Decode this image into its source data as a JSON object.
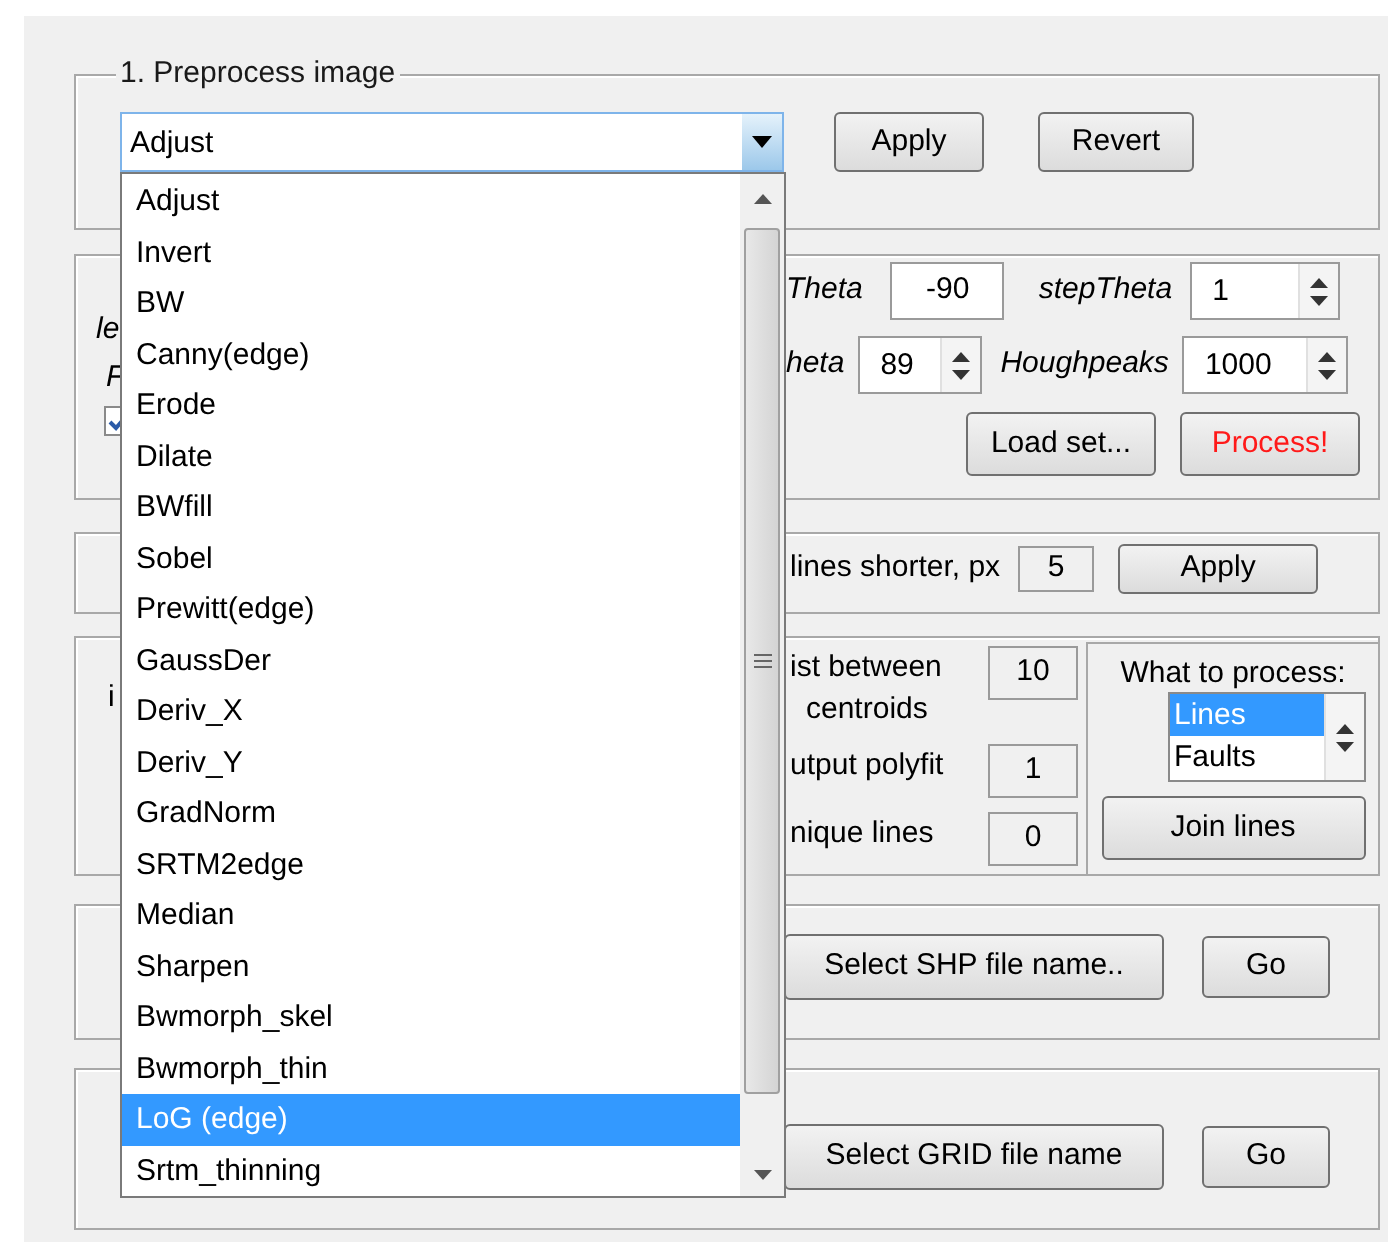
{
  "preprocess": {
    "title": "1. Preprocess image",
    "combo_value": "Adjust",
    "buttons": [
      "Apply",
      "Revert"
    ]
  },
  "dropdown": {
    "items": [
      {
        "label": "Adjust",
        "selected": false
      },
      {
        "label": "Invert",
        "selected": false
      },
      {
        "label": "BW",
        "selected": false
      },
      {
        "label": "Canny(edge)",
        "selected": false
      },
      {
        "label": "Erode",
        "selected": false
      },
      {
        "label": "Dilate",
        "selected": false
      },
      {
        "label": "BWfill",
        "selected": false
      },
      {
        "label": "Sobel",
        "selected": false
      },
      {
        "label": "Prewitt(edge)",
        "selected": false
      },
      {
        "label": "GaussDer",
        "selected": false
      },
      {
        "label": "Deriv_X",
        "selected": false
      },
      {
        "label": "Deriv_Y",
        "selected": false
      },
      {
        "label": "GradNorm",
        "selected": false
      },
      {
        "label": "SRTM2edge",
        "selected": false
      },
      {
        "label": "Median",
        "selected": false
      },
      {
        "label": "Sharpen",
        "selected": false
      },
      {
        "label": "Bwmorph_skel",
        "selected": false
      },
      {
        "label": "Bwmorph_thin",
        "selected": false
      },
      {
        "label": "LoG (edge)",
        "selected": true
      },
      {
        "label": "Srtm_thinning",
        "selected": false
      }
    ]
  },
  "hough": {
    "fragments": [
      "le",
      "F"
    ],
    "checkbox": {
      "checked": true
    },
    "rows": [
      [
        {
          "label": "Theta",
          "value": "-90",
          "kind": "field"
        },
        {
          "label": "stepTheta",
          "value": "1",
          "kind": "spinner"
        }
      ],
      [
        {
          "label": "heta",
          "value": "89",
          "kind": "spinner"
        },
        {
          "label": "Houghpeaks",
          "value": "1000",
          "kind": "spinner"
        }
      ]
    ],
    "buttons": [
      {
        "label": "Load set...",
        "highlighted": false
      },
      {
        "label": "Process!",
        "highlighted": true
      }
    ]
  },
  "filter": {
    "label": "lines shorter, px",
    "value": "5",
    "button": "Apply"
  },
  "join": {
    "fragments": [
      "i"
    ],
    "params": [
      {
        "lines": [
          "ist between",
          "centroids"
        ],
        "value": "10"
      },
      {
        "lines": [
          "utput polyfit"
        ],
        "value": "1"
      },
      {
        "lines": [
          "nique lines"
        ],
        "value": "0"
      }
    ],
    "process_label": "What to process:",
    "process_options": [
      {
        "label": "Lines",
        "selected": true
      },
      {
        "label": "Faults",
        "selected": false
      }
    ],
    "button": "Join lines"
  },
  "shp": {
    "button": "Select SHP file name..",
    "go": "Go"
  },
  "grid": {
    "button": "Select GRID file name",
    "go": "Go"
  }
}
